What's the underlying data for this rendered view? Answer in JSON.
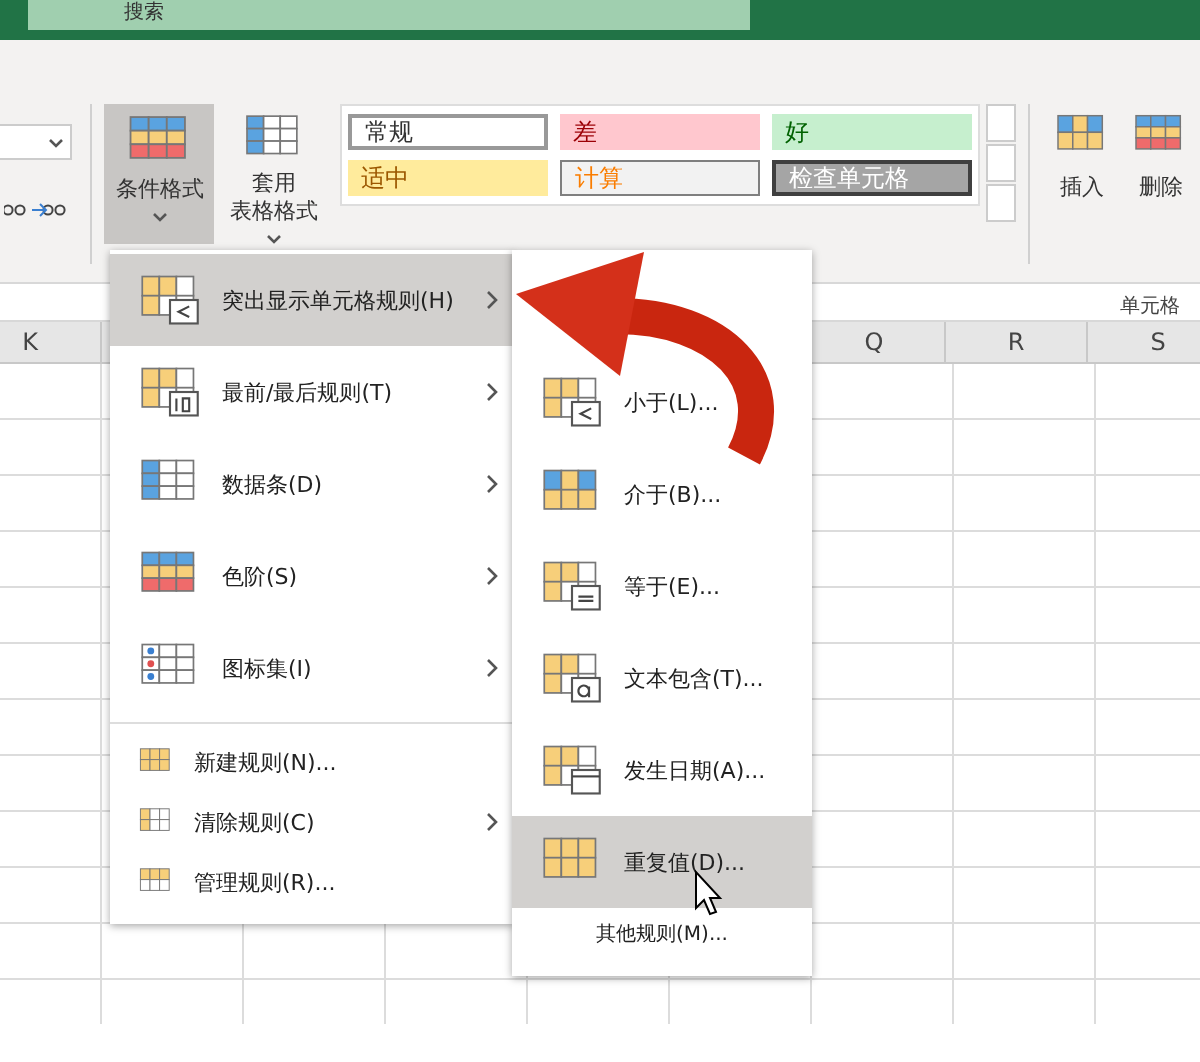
{
  "search": {
    "placeholder": "搜索"
  },
  "ribbon": {
    "buttons": [
      {
        "lines": [
          "条件格式"
        ],
        "selected": true,
        "kind": "conditional"
      },
      {
        "lines": [
          "套用",
          "表格格式"
        ],
        "selected": false,
        "kind": "table"
      }
    ],
    "cell_styles": [
      {
        "label": "常规",
        "kind": "normal"
      },
      {
        "label": "差",
        "kind": "bad"
      },
      {
        "label": "好",
        "kind": "good"
      },
      {
        "label": "适中",
        "kind": "neutral"
      },
      {
        "label": "计算",
        "kind": "calculation"
      },
      {
        "label": "检查单元格",
        "kind": "check"
      }
    ],
    "cell_buttons": [
      {
        "label": "插入",
        "kind": "insert"
      },
      {
        "label": "删除",
        "kind": "delete"
      }
    ],
    "group_label": "单元格"
  },
  "columns": [
    {
      "label": "K",
      "kind": "left"
    },
    {
      "label": "Q",
      "kind": "right"
    },
    {
      "label": "R",
      "kind": "right"
    },
    {
      "label": "S",
      "kind": "right"
    }
  ],
  "menu": {
    "items": [
      {
        "label": "突出显示单元格规则(H)",
        "kind": "highlight",
        "submenu": true,
        "selected": true
      },
      {
        "label": "最前/最后规则(T)",
        "kind": "topbottom",
        "submenu": true,
        "selected": false
      },
      {
        "label": "数据条(D)",
        "kind": "databar",
        "submenu": true,
        "selected": false
      },
      {
        "label": "色阶(S)",
        "kind": "colorscale",
        "submenu": true,
        "selected": false
      },
      {
        "label": "图标集(I)",
        "kind": "iconset",
        "submenu": true,
        "selected": false
      }
    ],
    "small_items": [
      {
        "label": "新建规则(N)...",
        "kind": "new",
        "submenu": false
      },
      {
        "label": "清除规则(C)",
        "kind": "clear",
        "submenu": true
      },
      {
        "label": "管理规则(R)...",
        "kind": "manage",
        "submenu": false
      }
    ]
  },
  "submenu": {
    "items": [
      {
        "label": "小于(L)...",
        "kind": "less",
        "selected": false
      },
      {
        "label": "介于(B)...",
        "kind": "between",
        "selected": false
      },
      {
        "label": "等于(E)...",
        "kind": "equal",
        "selected": false
      },
      {
        "label": "文本包含(T)...",
        "kind": "text",
        "selected": false
      },
      {
        "label": "发生日期(A)...",
        "kind": "date",
        "selected": false
      },
      {
        "label": "重复值(D)...",
        "kind": "duplicate",
        "selected": true
      }
    ],
    "footer": "其他规则(M)..."
  }
}
